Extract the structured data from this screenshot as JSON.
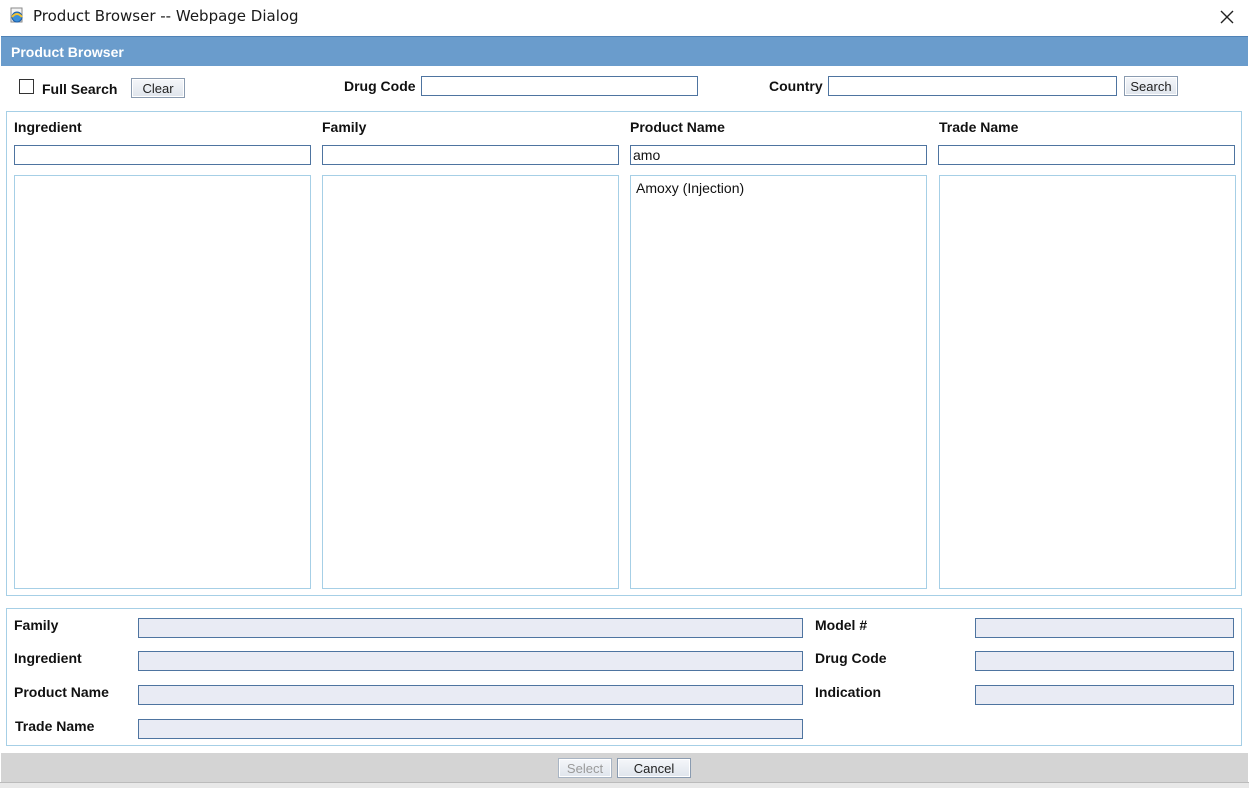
{
  "window": {
    "title": "Product Browser -- Webpage Dialog",
    "icon": "ie-page-icon",
    "close_icon": "close-icon"
  },
  "header": {
    "title": "Product Browser"
  },
  "search": {
    "full_search_label": "Full Search",
    "full_search_checked": false,
    "clear_label": "Clear",
    "drug_code_label": "Drug Code",
    "drug_code_value": "",
    "country_label": "Country",
    "country_value": "",
    "search_label": "Search"
  },
  "browser": {
    "columns": [
      {
        "header": "Ingredient",
        "filter_value": "",
        "items": []
      },
      {
        "header": "Family",
        "filter_value": "",
        "items": []
      },
      {
        "header": "Product Name",
        "filter_value": "amo",
        "items": [
          "Amoxy (Injection)"
        ]
      },
      {
        "header": "Trade Name",
        "filter_value": "",
        "items": []
      }
    ]
  },
  "details": {
    "left": [
      {
        "label": "Family",
        "value": ""
      },
      {
        "label": "Ingredient",
        "value": ""
      },
      {
        "label": "Product Name",
        "value": ""
      },
      {
        "label": "Trade Name",
        "value": ""
      }
    ],
    "right": [
      {
        "label": "Model #",
        "value": ""
      },
      {
        "label": "Drug Code",
        "value": ""
      },
      {
        "label": "Indication",
        "value": ""
      }
    ]
  },
  "footer": {
    "select_label": "Select",
    "select_enabled": false,
    "cancel_label": "Cancel"
  },
  "colors": {
    "header_band": "#6a9ccc",
    "panel_border": "#a6cfe6",
    "input_border": "#4e74a0",
    "readonly_bg": "#e9ebf4",
    "bottom_bar": "#d4d4d4"
  }
}
